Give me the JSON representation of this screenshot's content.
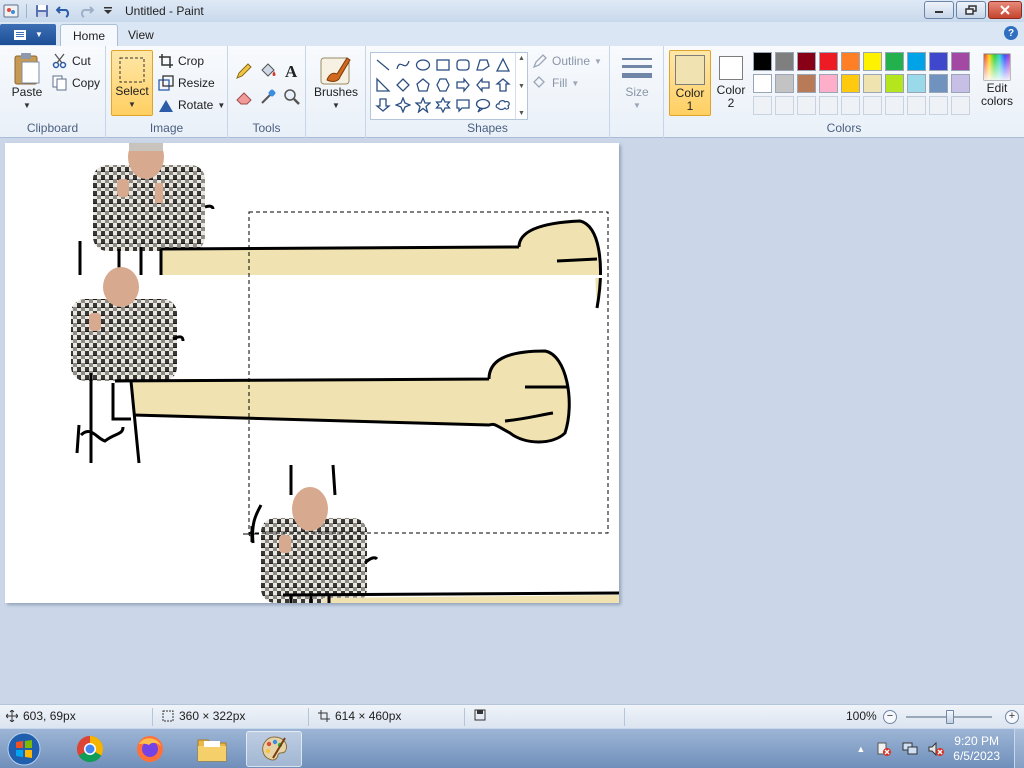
{
  "window": {
    "title": "Untitled - Paint"
  },
  "tabs": [
    {
      "label": "Home",
      "active": true
    },
    {
      "label": "View",
      "active": false
    }
  ],
  "ribbon": {
    "clipboard": {
      "group_label": "Clipboard",
      "paste": "Paste",
      "cut": "Cut",
      "copy": "Copy"
    },
    "image": {
      "group_label": "Image",
      "select": "Select",
      "crop": "Crop",
      "resize": "Resize",
      "rotate": "Rotate"
    },
    "tools": {
      "group_label": "Tools"
    },
    "brushes": {
      "label": "Brushes"
    },
    "shapes": {
      "group_label": "Shapes",
      "outline": "Outline",
      "fill": "Fill"
    },
    "size": {
      "label": "Size"
    },
    "colors": {
      "group_label": "Colors",
      "color1_label": "Color 1",
      "color2_label": "Color 2",
      "color1_value": "#f0e3b1",
      "color2_value": "#ffffff",
      "edit_colors": "Edit colors",
      "palette_row1": [
        "#000000",
        "#7f7f7f",
        "#880015",
        "#ed1c24",
        "#ff7f27",
        "#fff200",
        "#22b14c",
        "#00a2e8",
        "#3f48cc",
        "#a349a4"
      ],
      "palette_row2": [
        "#ffffff",
        "#c3c3c3",
        "#b97a57",
        "#ffaec9",
        "#ffc90e",
        "#efe4b0",
        "#b5e61d",
        "#99d9ea",
        "#7092be",
        "#c8bfe7"
      ]
    }
  },
  "statusbar": {
    "cursor_pos": "603, 69px",
    "selection_size": "360 × 322px",
    "image_size": "614 × 460px",
    "zoom": "100%"
  },
  "taskbar": {
    "time": "9:20 PM",
    "date": "6/5/2023"
  }
}
